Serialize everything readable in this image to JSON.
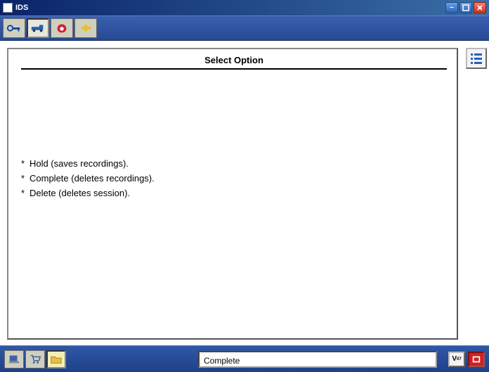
{
  "window": {
    "title": "IDS"
  },
  "panel": {
    "heading": "Select Option",
    "options": [
      "Hold (saves recordings).",
      "Complete (deletes recordings).",
      "Delete (deletes session)."
    ]
  },
  "status": {
    "text": "Complete"
  },
  "icons": {
    "toolbar": [
      "key-icon",
      "vehicle-icon",
      "diagnostic-icon",
      "back-arrow-icon"
    ],
    "side": [
      "list-menu-icon"
    ],
    "bottom_left": [
      "system-icon",
      "cart-icon",
      "folder-open-icon"
    ],
    "bottom_right_label": "V",
    "bottom_right_sub": "07"
  },
  "colors": {
    "titlebar_start": "#0a246a",
    "titlebar_end": "#3a6ea5",
    "toolbar_bg": "#274a95",
    "accent_blue": "#2a63b8",
    "close_red": "#d03020"
  }
}
